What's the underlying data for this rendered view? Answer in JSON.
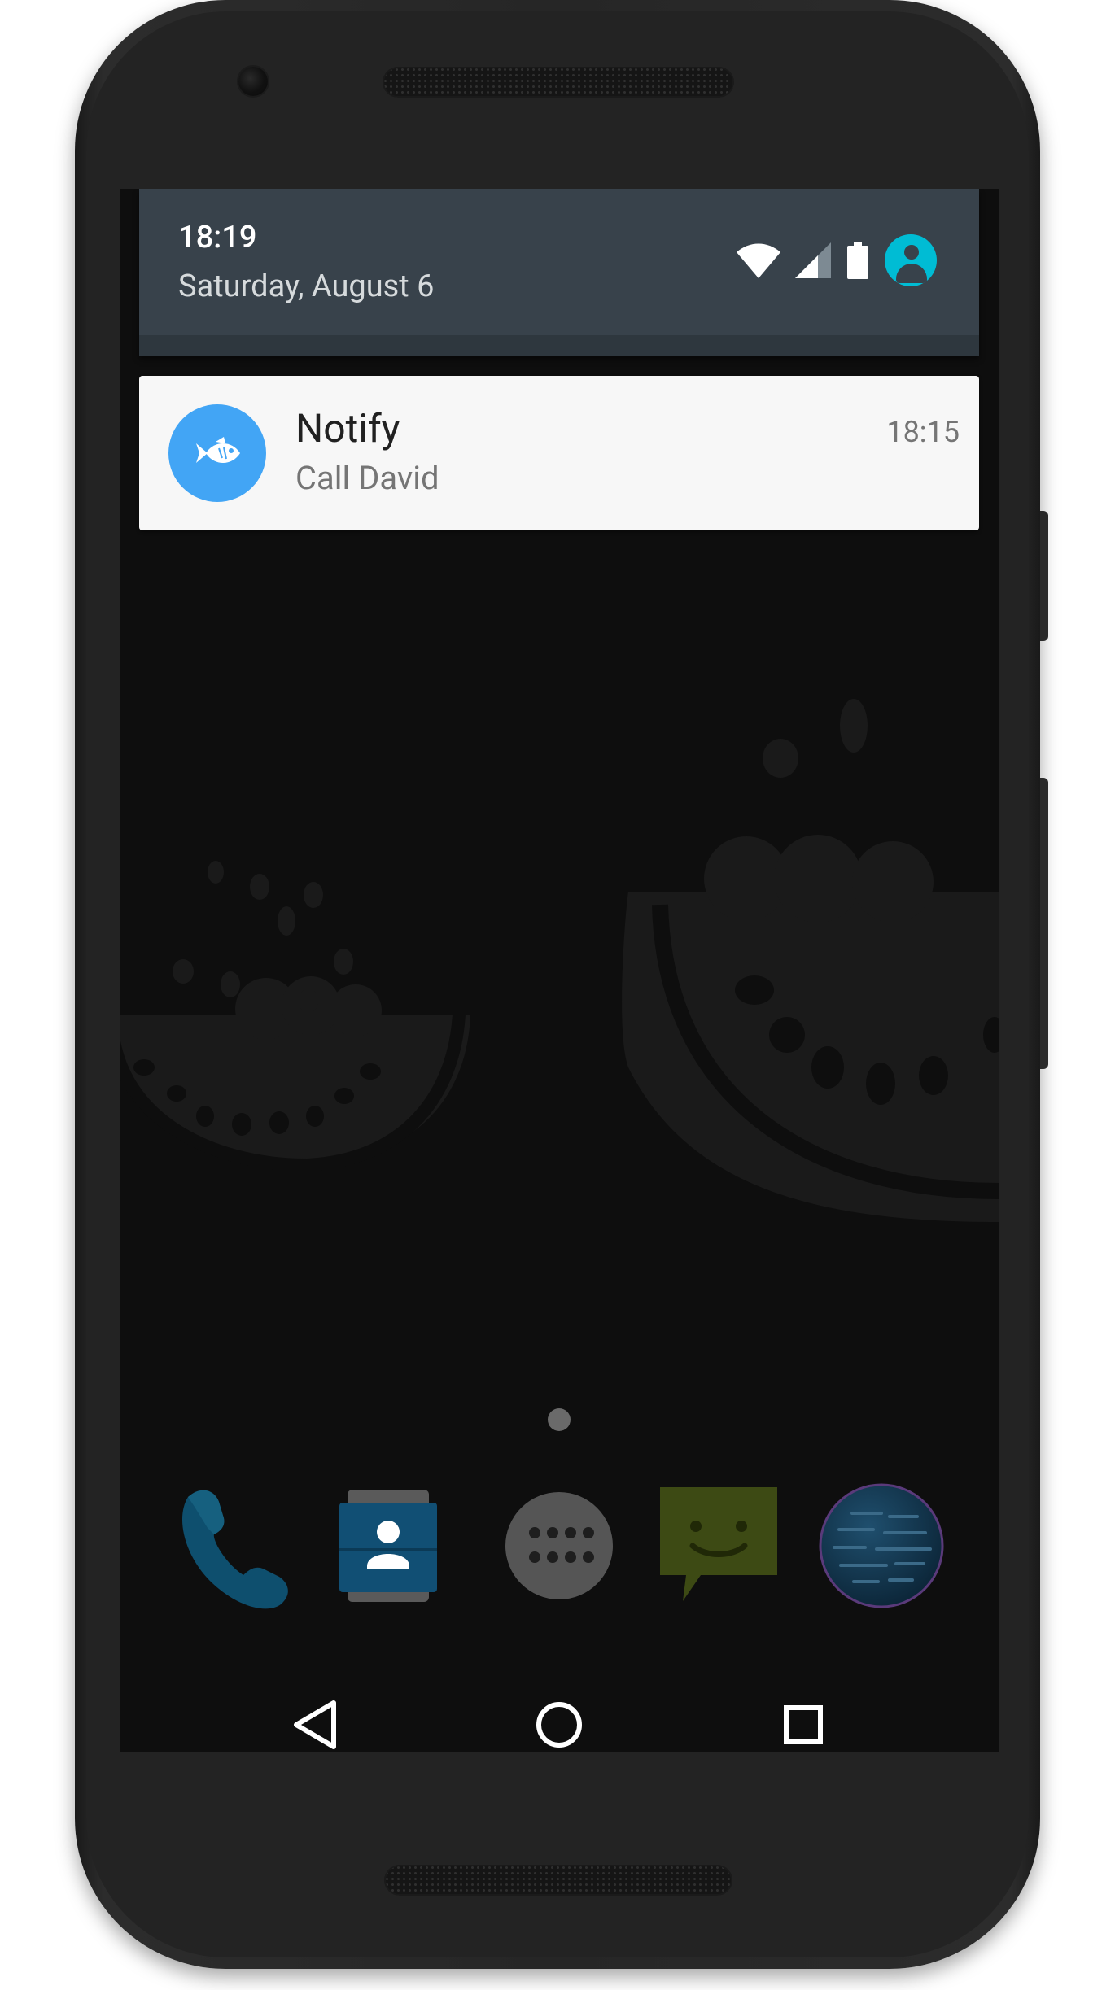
{
  "status_bar": {
    "time": "18:19",
    "date": "Saturday, August 6",
    "icons": [
      "wifi-icon",
      "cellular-signal-icon",
      "battery-icon",
      "user-avatar-icon"
    ],
    "accent_color": "#00bcd4"
  },
  "notification": {
    "app_name": "Notify",
    "text": "Call David",
    "time": "18:15",
    "icon": "fish-icon",
    "icon_color": "#42a5f5"
  },
  "home": {
    "page_indicator_count": 1,
    "dock": [
      {
        "name": "phone-app-icon"
      },
      {
        "name": "contacts-app-icon"
      },
      {
        "name": "app-drawer-icon"
      },
      {
        "name": "messages-app-icon"
      },
      {
        "name": "browser-app-icon"
      }
    ]
  },
  "nav_bar": {
    "buttons": [
      "back-icon",
      "home-icon",
      "recents-icon"
    ]
  }
}
